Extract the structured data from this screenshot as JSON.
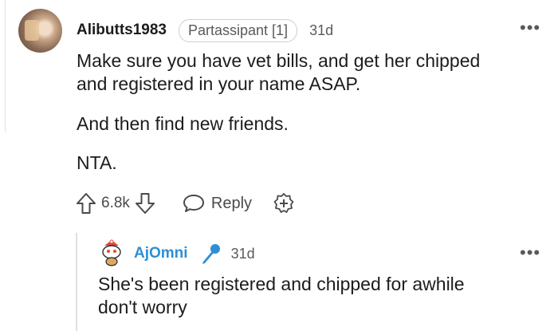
{
  "comment": {
    "username": "Alibutts1983",
    "flair": "Partassipant [1]",
    "time": "31d",
    "paragraphs": [
      "Make sure you have vet bills, and get her chipped",
      "and registered in your name ASAP.",
      "And then find new friends.",
      "NTA."
    ],
    "score": "6.8k",
    "reply_label": "Reply",
    "more_label": "•••"
  },
  "reply": {
    "username": "AjOmni",
    "time": "31d",
    "lines": [
      "She's been registered and chipped for awhile",
      "don't worry"
    ],
    "more_label": "•••"
  },
  "colors": {
    "reply_username": "#2d8fd6",
    "text": "#1c1c1c",
    "muted": "#5a5a5a"
  },
  "icons": [
    "upvote-icon",
    "downvote-icon",
    "chat-bubble-icon",
    "award-plus-icon",
    "microphone-icon",
    "more-icon"
  ]
}
